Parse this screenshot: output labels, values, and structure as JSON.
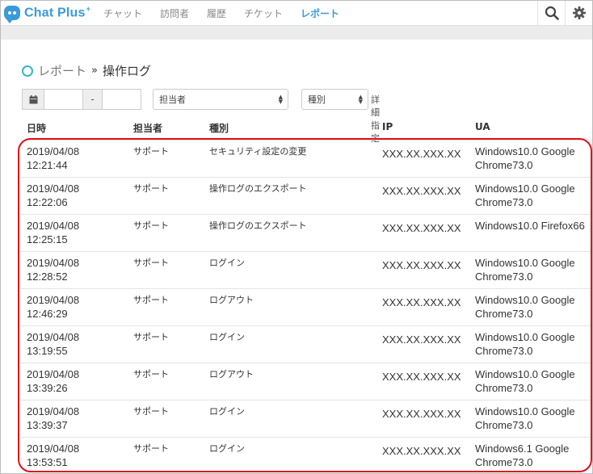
{
  "nav": {
    "logo": "Chat Plus",
    "logo_sup": "+",
    "items": [
      {
        "label": "チャット"
      },
      {
        "label": "訪問者"
      },
      {
        "label": "履歴"
      },
      {
        "label": "チケット"
      },
      {
        "label": "レポート",
        "active": true
      }
    ]
  },
  "breadcrumb": {
    "parent": "レポート",
    "separator": "»",
    "current": "操作ログ"
  },
  "filters": {
    "date_separator": "-",
    "operator_select": "担当者",
    "type_select": "種別",
    "detail_link": "詳細指定"
  },
  "table": {
    "headers": [
      "日時",
      "担当者",
      "種別",
      "IP",
      "UA"
    ],
    "rows": [
      {
        "date": "2019/04/08",
        "time": "12:21:44",
        "user": "サポート",
        "type": "セキュリティ設定の変更",
        "ip": "XXX.XX.XXX.XX",
        "ua1": "Windows10.0 Google",
        "ua2": "Chrome73.0"
      },
      {
        "date": "2019/04/08",
        "time": "12:22:06",
        "user": "サポート",
        "type": "操作ログのエクスポート",
        "ip": "XXX.XX.XXX.XX",
        "ua1": "Windows10.0 Google",
        "ua2": "Chrome73.0"
      },
      {
        "date": "2019/04/08",
        "time": "12:25:15",
        "user": "サポート",
        "type": "操作ログのエクスポート",
        "ip": "XXX.XX.XXX.XX",
        "ua1": "Windows10.0 Firefox66",
        "ua2": ""
      },
      {
        "date": "2019/04/08",
        "time": "12:28:52",
        "user": "サポート",
        "type": "ログイン",
        "ip": "XXX.XX.XXX.XX",
        "ua1": "Windows10.0 Google",
        "ua2": "Chrome73.0"
      },
      {
        "date": "2019/04/08",
        "time": "12:46:29",
        "user": "サポート",
        "type": "ログアウト",
        "ip": "XXX.XX.XXX.XX",
        "ua1": "Windows10.0 Google",
        "ua2": "Chrome73.0"
      },
      {
        "date": "2019/04/08",
        "time": "13:19:55",
        "user": "サポート",
        "type": "ログイン",
        "ip": "XXX.XX.XXX.XX",
        "ua1": "Windows10.0 Google",
        "ua2": "Chrome73.0"
      },
      {
        "date": "2019/04/08",
        "time": "13:39:26",
        "user": "サポート",
        "type": "ログアウト",
        "ip": "XXX.XX.XXX.XX",
        "ua1": "Windows10.0 Google",
        "ua2": "Chrome73.0"
      },
      {
        "date": "2019/04/08",
        "time": "13:39:37",
        "user": "サポート",
        "type": "ログイン",
        "ip": "XXX.XX.XXX.XX",
        "ua1": "Windows10.0 Google",
        "ua2": "Chrome73.0"
      },
      {
        "date": "2019/04/08",
        "time": "13:53:51",
        "user": "サポート",
        "type": "ログイン",
        "ip": "XXX.XX.XXX.XX",
        "ua1": "Windows6.1 Google",
        "ua2": "Chrome73.0"
      }
    ]
  },
  "colors": {
    "brand": "#3a9ad9",
    "highlight": "#e0101a"
  },
  "icons": [
    "chat-bubble-icon",
    "search-icon",
    "gear-icon",
    "calendar-icon",
    "circle-icon"
  ]
}
